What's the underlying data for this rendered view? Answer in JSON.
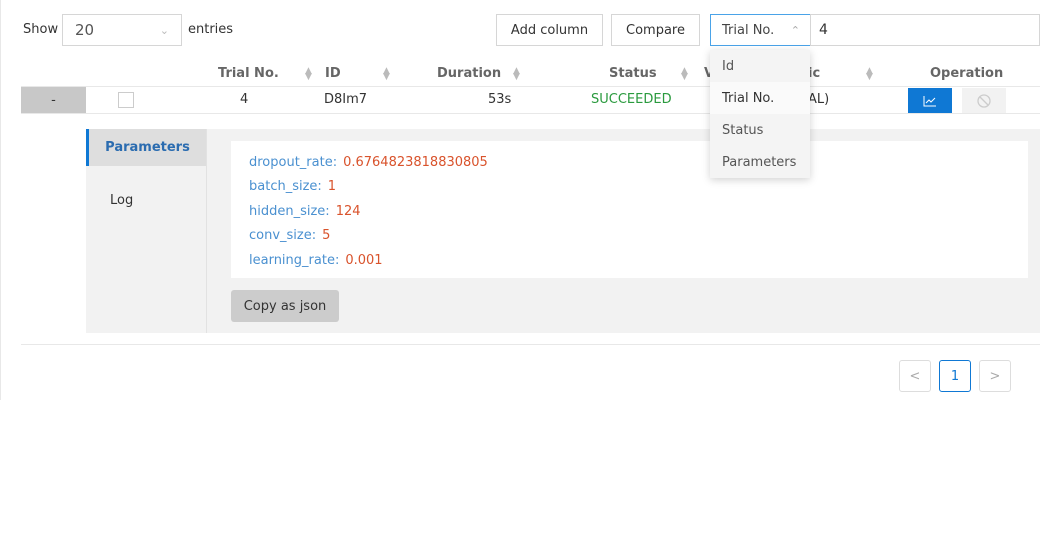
{
  "toolbar": {
    "show_label": "Show",
    "entries_value": "20",
    "entries_label": "entries",
    "add_column": "Add column",
    "compare": "Compare",
    "search_field": "Trial No.",
    "search_value": "4"
  },
  "dropdown": {
    "options": [
      "Id",
      "Trial No.",
      "Status",
      "Parameters"
    ],
    "selected": "Trial No."
  },
  "table": {
    "headers": {
      "trial_no": "Trial No.",
      "id": "ID",
      "duration": "Duration",
      "status": "Status",
      "hidden_left": "V",
      "hidden_right": "ic",
      "operation": "Operation"
    },
    "row": {
      "expand": "-",
      "trial_no": "4",
      "id": "D8Im7",
      "duration": "53s",
      "status": "SUCCEEDED",
      "metric_partial": "AL)"
    }
  },
  "detail": {
    "tabs": [
      "Parameters",
      "Log"
    ],
    "active_tab": "Parameters",
    "params": [
      {
        "key": "dropout_rate:",
        "value": "0.6764823818830805"
      },
      {
        "key": "batch_size:",
        "value": "1"
      },
      {
        "key": "hidden_size:",
        "value": "124"
      },
      {
        "key": "conv_size:",
        "value": "5"
      },
      {
        "key": "learning_rate:",
        "value": "0.001"
      }
    ],
    "copy_button": "Copy as json"
  },
  "pagination": {
    "prev": "<",
    "current": "1",
    "next": ">"
  },
  "colors": {
    "accent": "#0f78d4",
    "success": "#2a9a3e",
    "param_key": "#4a90d0",
    "param_value": "#d9532c"
  }
}
